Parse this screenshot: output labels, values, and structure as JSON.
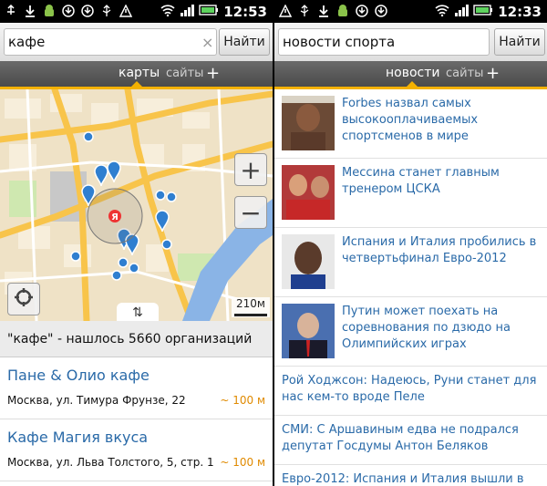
{
  "left": {
    "status": {
      "time": "12:53",
      "icons": [
        "usb-icon",
        "download-icon",
        "android-icon",
        "download-icon",
        "download-icon",
        "usb-icon",
        "warning-icon",
        "wifi-icon",
        "signal-icon",
        "battery-icon"
      ]
    },
    "search": {
      "value": "кафе",
      "button": "Найти",
      "clear": "×"
    },
    "tabs": {
      "maps": "карты",
      "sites": "сайты",
      "add": "+"
    },
    "map": {
      "zoom_in": "+",
      "zoom_out": "−",
      "scale": "210м",
      "handle": "⇅"
    },
    "results_count": "\"кафе\" - нашлось 5660 организаций",
    "results": [
      {
        "title": "Пане & Олио кафе",
        "address": "Москва, ул. Тимура Фрунзе, 22",
        "distance": "~ 100 м"
      },
      {
        "title": "Кафе Магия вкуса",
        "address": "Москва, ул. Льва Толстого, 5, стр. 1",
        "distance": "~ 100 м"
      }
    ]
  },
  "right": {
    "status": {
      "time": "12:33"
    },
    "search": {
      "value": "новости спорта",
      "button": "Найти"
    },
    "tabs": {
      "news": "новости",
      "sites": "сайты",
      "add": "+"
    },
    "news": [
      {
        "title": "Forbes назвал самых высокооплачиваемых спортсменов в мире",
        "has_image": true
      },
      {
        "title": "Месси­на станет главным тренером ЦСКА",
        "has_image": true
      },
      {
        "title": "Испания и Италия пробились в четвертьфинал Евро-2012",
        "has_image": true
      },
      {
        "title": "Путин может поехать на соревнования по дзюдо на Олимпийских играх",
        "has_image": true
      },
      {
        "title": "Рой Ходжсон: Надеюсь, Руни станет для нас кем-то вроде Пеле",
        "has_image": false
      },
      {
        "title": "СМИ: С Аршавиным едва не подрался депутат Госдумы Антон Беляков",
        "has_image": false
      },
      {
        "title": "Евро-2012: Испания и Италия вышли в",
        "has_image": false
      }
    ]
  },
  "colors": {
    "accent": "#f4b100",
    "link": "#2a6aa8",
    "distance": "#e08a00"
  }
}
